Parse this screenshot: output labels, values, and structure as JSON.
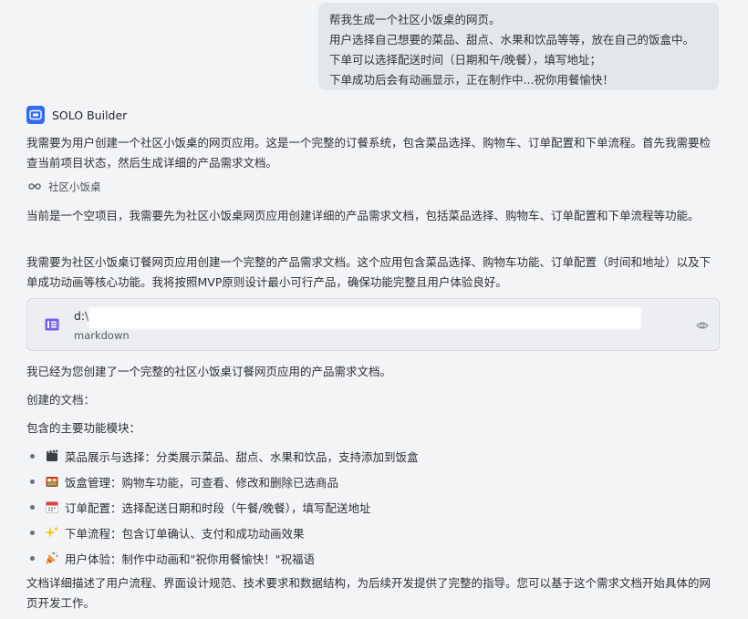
{
  "user_message": {
    "lines": [
      "帮我生成一个社区小饭桌的网页。",
      "用户选择自己想要的菜品、甜点、水果和饮品等等，放在自己的饭盒中。",
      "下单可以选择配送时间（日期和午/晚餐），填写地址；",
      "下单成功后会有动画显示，正在制作中...祝你用餐愉快！"
    ]
  },
  "assistant": {
    "name": "SOLO Builder",
    "logo_color": "#2f6df6",
    "intro": "我需要为用户创建一个社区小饭桌的网页应用。这是一个完整的订餐系统，包含菜品选择、购物车、订单配置和下单流程。首先我需要检查当前项目状态，然后生成详细的产品需求文档。",
    "project_tag": "社区小饭桌",
    "status": "当前是一个空项目，我需要先为社区小饭桌网页应用创建详细的产品需求文档，包括菜品选择、购物车、订单配置和下单流程等功能。",
    "plan": "我需要为社区小饭桌订餐网页应用创建一个完整的产品需求文档。这个应用包含菜品选择、购物车功能、订单配置（时间和地址）以及下单成功动画等核心功能。我将按照MVP原则设计最小可行产品，确保功能完整且用户体验良好。",
    "file_card": {
      "path": "d:\\",
      "type": "markdown",
      "icon": "document-icon",
      "action_icon": "eye-icon"
    },
    "done": "我已经为您创建了一个完整的社区小饭桌订餐网页应用的产品需求文档。",
    "created_docs_label": "创建的文档：",
    "modules_label": "包含的主要功能模块：",
    "features": [
      {
        "icon": "clapper-board-icon",
        "text": "菜品展示与选择：分类展示菜品、甜点、水果和饮品，支持添加到饭盒"
      },
      {
        "icon": "bento-box-icon",
        "text": "饭盒管理：购物车功能，可查看、修改和删除已选商品"
      },
      {
        "icon": "calendar-icon",
        "text": "订单配置：选择配送日期和时段（午餐/晚餐），填写配送地址"
      },
      {
        "icon": "sparkles-icon",
        "text": "下单流程：包含订单确认、支付和成功动画效果"
      },
      {
        "icon": "party-popper-icon",
        "text": "用户体验：制作中动画和\"祝你用餐愉快！\"祝福语"
      }
    ],
    "summary": "文档详细描述了用户流程、界面设计规范、技术要求和数据结构，为后续开发提供了完整的指导。您可以基于这个需求文档开始具体的网页开发工作。"
  }
}
